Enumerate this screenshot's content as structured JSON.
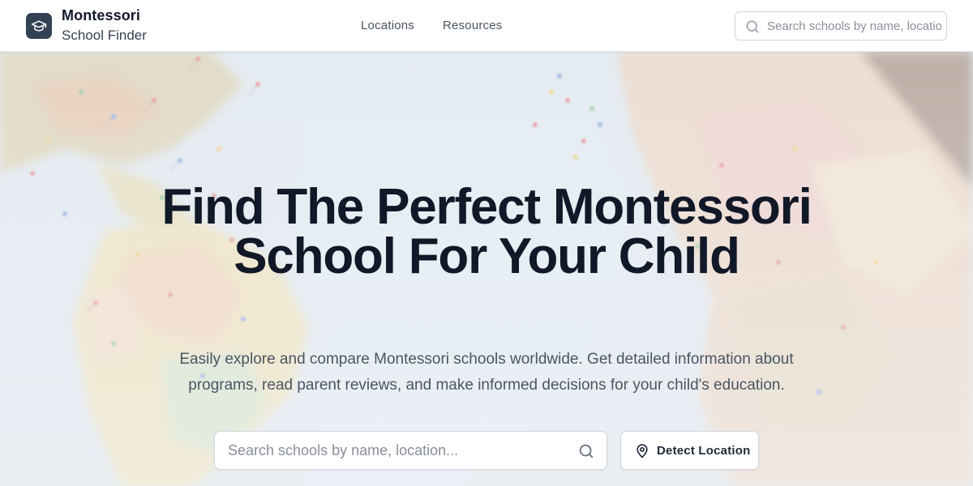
{
  "brand": {
    "name_line1": "Montessori",
    "name_line2": "School Finder",
    "logo_icon": "graduation-cap-icon"
  },
  "nav": {
    "items": [
      {
        "label": "Locations"
      },
      {
        "label": "Resources"
      }
    ]
  },
  "header_search": {
    "placeholder": "Search schools by name, location...",
    "icon": "search-icon"
  },
  "hero": {
    "title": "Find The Perfect Montessori School For Your Child",
    "subtitle": "Easily explore and compare Montessori schools worldwide. Get detailed information about programs, read parent reviews, and make informed decisions for your child's education.",
    "search": {
      "placeholder": "Search schools by name, location...",
      "icon": "search-icon"
    },
    "detect_button": {
      "label": "Detect Location",
      "icon": "map-pin-icon"
    },
    "background": "world-map-with-pins"
  },
  "colors": {
    "text_dark": "#111827",
    "text_muted": "#4b5563",
    "logo_bg": "#334155",
    "border": "#d1d5db",
    "header_bg": "#ffffff"
  }
}
